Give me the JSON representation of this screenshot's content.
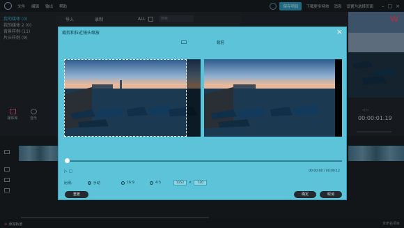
{
  "menu": [
    "文件",
    "编辑",
    "输出",
    "帮助"
  ],
  "top_bar": {
    "save_label": "保存项目",
    "links": [
      "下载更多特效",
      "消息",
      "设置为选择页面"
    ]
  },
  "library": {
    "items": [
      "我的媒体 (0)",
      "我的媒体 2 (0)",
      "背景样例 (11)",
      "片头样例 (9)"
    ]
  },
  "media_toolbar": {
    "import_label": "导入",
    "record_label": "录制",
    "all_label": "ALL",
    "search_placeholder": "搜索"
  },
  "module_tabs": [
    "媒体库",
    "音乐"
  ],
  "player": {
    "time": "00:00:01.19"
  },
  "timeline": {
    "add_track_label": "添加轨道",
    "corner_text": "未命名项目"
  },
  "dialog": {
    "title": "裁剪和拉近镜头缩放",
    "section_label": "裁剪",
    "time": "00:00:00 / 00:00:12",
    "ratio_label": "比例:",
    "ratios": [
      "手动",
      "16:9",
      "4:3"
    ],
    "selected_ratio": "手动",
    "width": "1152",
    "height": "720",
    "reset_label": "重置",
    "ok_label": "确定",
    "cancel_label": "取消",
    "crop_fraction": 0.9
  },
  "colors": {
    "dialog_bg": "#5cc3d8",
    "accent": "#2aa5c9",
    "brand": "#e05a6d"
  }
}
